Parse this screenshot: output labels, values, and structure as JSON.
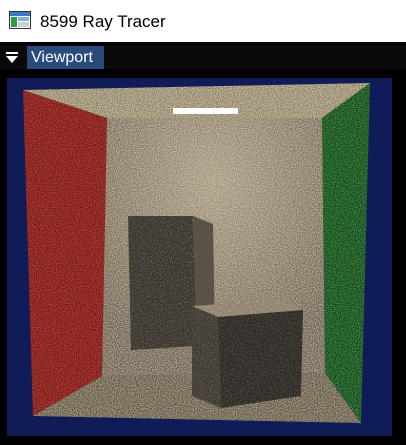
{
  "window": {
    "title": "8599 Ray Tracer",
    "icon": "app-window-icon"
  },
  "panel": {
    "collapse_icon": "collapse-arrow-icon",
    "tab_label": "Viewport"
  },
  "viewport": {
    "scene": "cornell-box-render",
    "colors": {
      "background": "#0f1c57",
      "left_wall": "#c8302d",
      "right_wall": "#2f8e3a",
      "back_wall": "#b9a88c",
      "ceiling": "#cbbf9d",
      "floor": "#b3a487",
      "light": "#ffffff",
      "tall_block": "#4a4540",
      "short_block": "#514b45"
    }
  }
}
